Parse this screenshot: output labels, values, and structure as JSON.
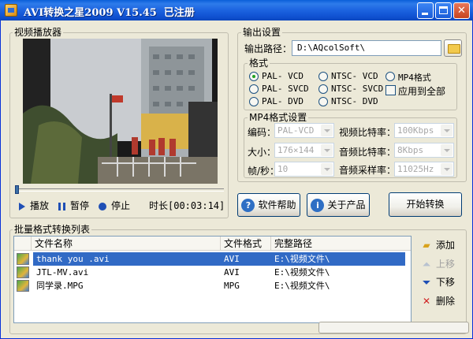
{
  "window": {
    "title": "AVI转换之星2009 V15.45  已注册"
  },
  "player": {
    "group_title": "视频播放器",
    "play_label": "播放",
    "pause_label": "暂停",
    "stop_label": "停止",
    "duration_text": "时长[00:03:14]"
  },
  "output": {
    "group_title": "输出设置",
    "path_label": "输出路径：",
    "path_value": "D:\\AQcolSoft\\"
  },
  "format": {
    "group_title": "格式",
    "options": [
      "PAL- VCD",
      "NTSC- VCD",
      "MP4格式",
      "PAL- SVCD",
      "NTSC- SVCD",
      "PAL- DVD",
      "NTSC- DVD"
    ],
    "selected": "PAL- VCD",
    "apply_all_label": "应用到全部"
  },
  "mp4": {
    "group_title": "MP4格式设置",
    "encode_label": "编码：",
    "encode_value": "PAL-VCD",
    "size_label": "大小：",
    "size_value": "176×144",
    "fps_label": "帧/秒：",
    "fps_value": "10",
    "vbitrate_label": "视频比特率：",
    "vbitrate_value": "100Kbps",
    "abitrate_label": "音频比特率：",
    "abitrate_value": "8Kbps",
    "asample_label": "音频采样率：",
    "asample_value": "11025Hz"
  },
  "buttons": {
    "help": "软件帮助",
    "about": "关于产品",
    "start": "开始转换"
  },
  "batch": {
    "group_title": "批量格式转换列表",
    "columns": [
      "文件名称",
      "文件格式",
      "完整路径"
    ],
    "rows": [
      {
        "name": "thank you .avi",
        "format": "AVI",
        "path": "E:\\视频文件\\"
      },
      {
        "name": "JTL-MV.avi",
        "format": "AVI",
        "path": "E:\\视频文件\\"
      },
      {
        "name": "同学录.MPG",
        "format": "MPG",
        "path": "E:\\视频文件\\"
      }
    ],
    "selected_row": 0,
    "add_label": "添加",
    "up_label": "上移",
    "down_label": "下移",
    "delete_label": "删除"
  },
  "colors": {
    "title_blue": "#0A5FD8",
    "selection": "#316AC5",
    "accent_green": "#21A121"
  }
}
